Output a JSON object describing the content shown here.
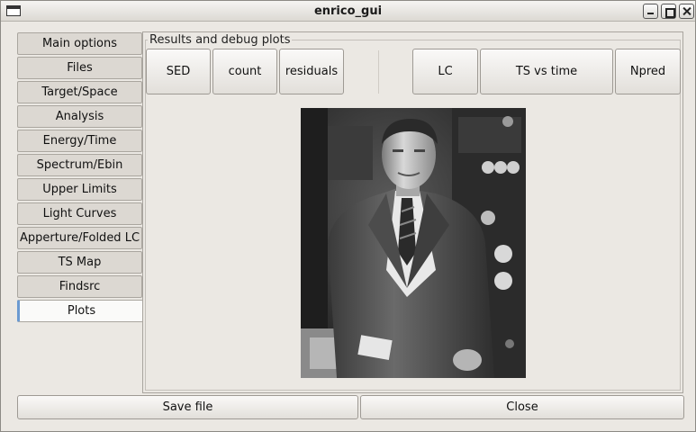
{
  "window": {
    "title": "enrico_gui"
  },
  "tabs": [
    {
      "label": "Main options",
      "active": false
    },
    {
      "label": "Files",
      "active": false
    },
    {
      "label": "Target/Space",
      "active": false
    },
    {
      "label": "Analysis",
      "active": false
    },
    {
      "label": "Energy/Time",
      "active": false
    },
    {
      "label": "Spectrum/Ebin",
      "active": false
    },
    {
      "label": "Upper Limits",
      "active": false
    },
    {
      "label": "Light Curves",
      "active": false
    },
    {
      "label": "Apperture/Folded LC",
      "active": false
    },
    {
      "label": "TS Map",
      "active": false
    },
    {
      "label": "Findsrc",
      "active": false
    },
    {
      "label": "Plots",
      "active": true
    }
  ],
  "plots_panel": {
    "group_title": "Results and debug plots",
    "buttons": {
      "sed": "SED",
      "count": "count",
      "residuals": "residuals",
      "lc": "LC",
      "ts_vs_time": "TS vs time",
      "npred": "Npred"
    }
  },
  "footer": {
    "save_label": "Save file",
    "close_label": "Close"
  },
  "colors": {
    "window_bg": "#ebe8e3",
    "active_tab_accent": "#6b9ad1"
  }
}
